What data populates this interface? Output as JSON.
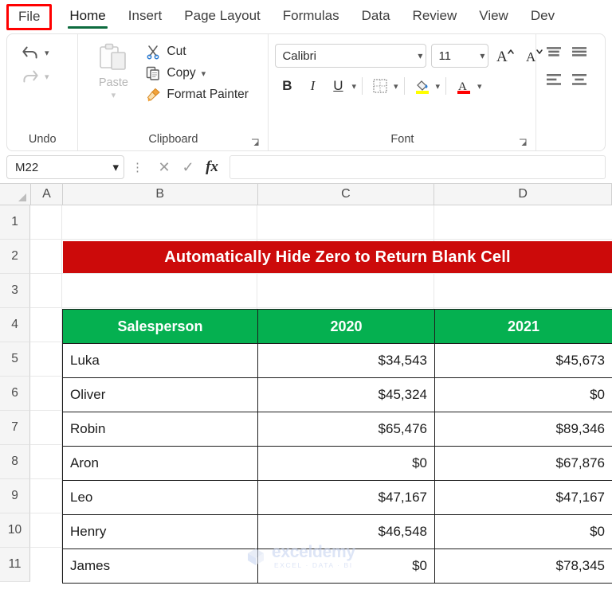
{
  "ribbon": {
    "tabs": [
      {
        "label": "File",
        "state": "highlighted"
      },
      {
        "label": "Home",
        "state": "active"
      },
      {
        "label": "Insert",
        "state": "normal"
      },
      {
        "label": "Page Layout",
        "state": "normal"
      },
      {
        "label": "Formulas",
        "state": "normal"
      },
      {
        "label": "Data",
        "state": "normal"
      },
      {
        "label": "Review",
        "state": "normal"
      },
      {
        "label": "View",
        "state": "normal"
      },
      {
        "label": "Dev",
        "state": "normal"
      }
    ],
    "groups": {
      "undo": {
        "label": "Undo",
        "undo_icon": "undo-arrow-icon",
        "redo_icon": "redo-arrow-icon"
      },
      "clipboard": {
        "label": "Clipboard",
        "paste_label": "Paste",
        "paste_icon": "clipboard-paste-icon",
        "cut_label": "Cut",
        "cut_icon": "scissors-icon",
        "copy_label": "Copy",
        "copy_icon": "copy-pages-icon",
        "format_painter_label": "Format Painter",
        "format_painter_icon": "paintbrush-icon",
        "launcher_icon": "dialog-launcher-icon"
      },
      "font": {
        "label": "Font",
        "font_name": "Calibri",
        "font_size": "11",
        "grow_font_icon": "increase-font-size-icon",
        "shrink_font_icon": "decrease-font-size-icon",
        "bold_label": "B",
        "italic_label": "I",
        "underline_label": "U",
        "borders_icon": "borders-icon",
        "fill_color_icon": "fill-color-icon",
        "font_color_icon": "font-color-icon",
        "fill_color_swatch": "#FFFF00",
        "font_color_swatch": "#FF0000",
        "launcher_icon": "dialog-launcher-icon"
      },
      "alignment": {
        "align_top_icon": "align-top-icon",
        "align_middle_icon": "align-middle-icon",
        "align_left_icon": "align-left-icon",
        "align_center_icon": "align-center-icon"
      }
    }
  },
  "formula_bar": {
    "name_box_value": "M22",
    "name_box_caret_icon": "chevron-down-icon",
    "more_icon": "vertical-dots-icon",
    "cancel_icon": "cancel-x-icon",
    "enter_icon": "enter-check-icon",
    "function_icon": "insert-function-fx-icon",
    "formula_value": ""
  },
  "grid": {
    "select_all_icon": "select-all-corner-icon",
    "columns": [
      "A",
      "B",
      "C",
      "D"
    ],
    "rows": [
      "1",
      "2",
      "3",
      "4",
      "5",
      "6",
      "7",
      "8",
      "9",
      "10",
      "11"
    ]
  },
  "banner": {
    "title": "Automatically Hide Zero to Return Blank Cell",
    "background": "#CC0A0A",
    "text_color": "#FFFFFF"
  },
  "table": {
    "header_background": "#05B050",
    "headers": [
      "Salesperson",
      "2020",
      "2021"
    ],
    "rows": [
      {
        "salesperson": "Luka",
        "y2020": "$34,543",
        "y2021": "$45,673"
      },
      {
        "salesperson": "Oliver",
        "y2020": "$45,324",
        "y2021": "$0"
      },
      {
        "salesperson": "Robin",
        "y2020": "$65,476",
        "y2021": "$89,346"
      },
      {
        "salesperson": "Aron",
        "y2020": "$0",
        "y2021": "$67,876"
      },
      {
        "salesperson": "Leo",
        "y2020": "$47,167",
        "y2021": "$47,167"
      },
      {
        "salesperson": "Henry",
        "y2020": "$46,548",
        "y2021": "$0"
      },
      {
        "salesperson": "James",
        "y2020": "$0",
        "y2021": "$78,345"
      }
    ]
  },
  "watermark": {
    "name": "exceldemy",
    "tagline": "EXCEL · DATA · BI",
    "logo_icon": "exceldemy-cube-logo-icon",
    "color": "#C3D0EF"
  }
}
